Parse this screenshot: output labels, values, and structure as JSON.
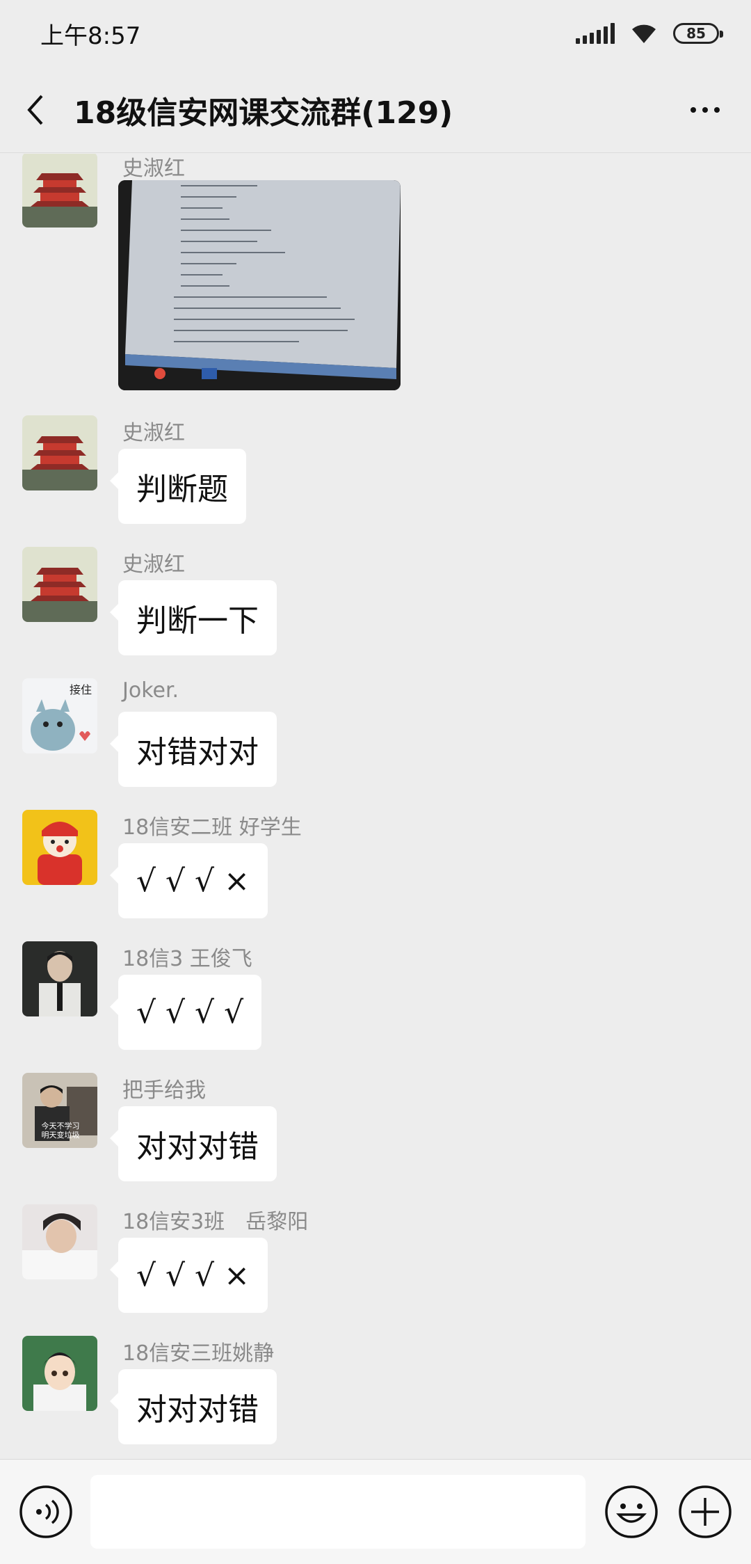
{
  "status_bar": {
    "time": "上午8:57",
    "battery": "85"
  },
  "header": {
    "title": "18级信安网课交流群(129)"
  },
  "messages": [
    {
      "sender": "史淑红",
      "type": "image",
      "avatar": "pagoda-avatar"
    },
    {
      "sender": "史淑红",
      "text": "判断题",
      "avatar": "pagoda-avatar"
    },
    {
      "sender": "史淑红",
      "text": "判断一下",
      "avatar": "pagoda-avatar"
    },
    {
      "sender": "Joker.",
      "text": "对错对对",
      "avatar": "cartoon-monster-avatar",
      "avatar_caption": "接住"
    },
    {
      "sender": "18信安二班 好学生",
      "text": " √ √ √ ×",
      "avatar": "cartoon-red-coat-avatar"
    },
    {
      "sender": "18信3 王俊飞",
      "text": " √ √ √ √",
      "avatar": "man-in-suit-avatar"
    },
    {
      "sender": "把手给我",
      "text": "对对对错",
      "avatar": "man-with-caption-avatar",
      "avatar_caption": "今天不学习 明天变垃圾"
    },
    {
      "sender": "18信安3班　岳黎阳",
      "text": " √ √ √ ×",
      "avatar": "portrait-avatar"
    },
    {
      "sender": "18信安三班姚静",
      "text": "对对对错",
      "avatar": "anime-boy-avatar"
    }
  ],
  "input_bar": {
    "placeholder": ""
  },
  "colors": {
    "background": "#ededed",
    "bubble": "#ffffff",
    "sender_name": "#8a8a8a"
  }
}
